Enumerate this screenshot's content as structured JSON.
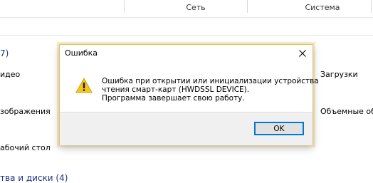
{
  "explorer": {
    "ribbon_tabs": [
      "Сеть",
      "Система"
    ],
    "items_left": [
      "идео",
      "зображения",
      "абочий стол"
    ],
    "items_right": [
      "Загрузки",
      "Объемные объ"
    ],
    "group_top": "7)",
    "group_bottom": "тва и диски (4)"
  },
  "dialog": {
    "title": "Ошибка",
    "message_lines": [
      "Ошибка при открытии или инициализации устройства",
      "чтения смарт-карт (HWDSSL DEVICE).",
      "Программа завершает свою работу."
    ],
    "ok_label": "OK",
    "icon": "warning-icon",
    "accent_color": "#0078d7",
    "warning_color": "#f5c518"
  }
}
